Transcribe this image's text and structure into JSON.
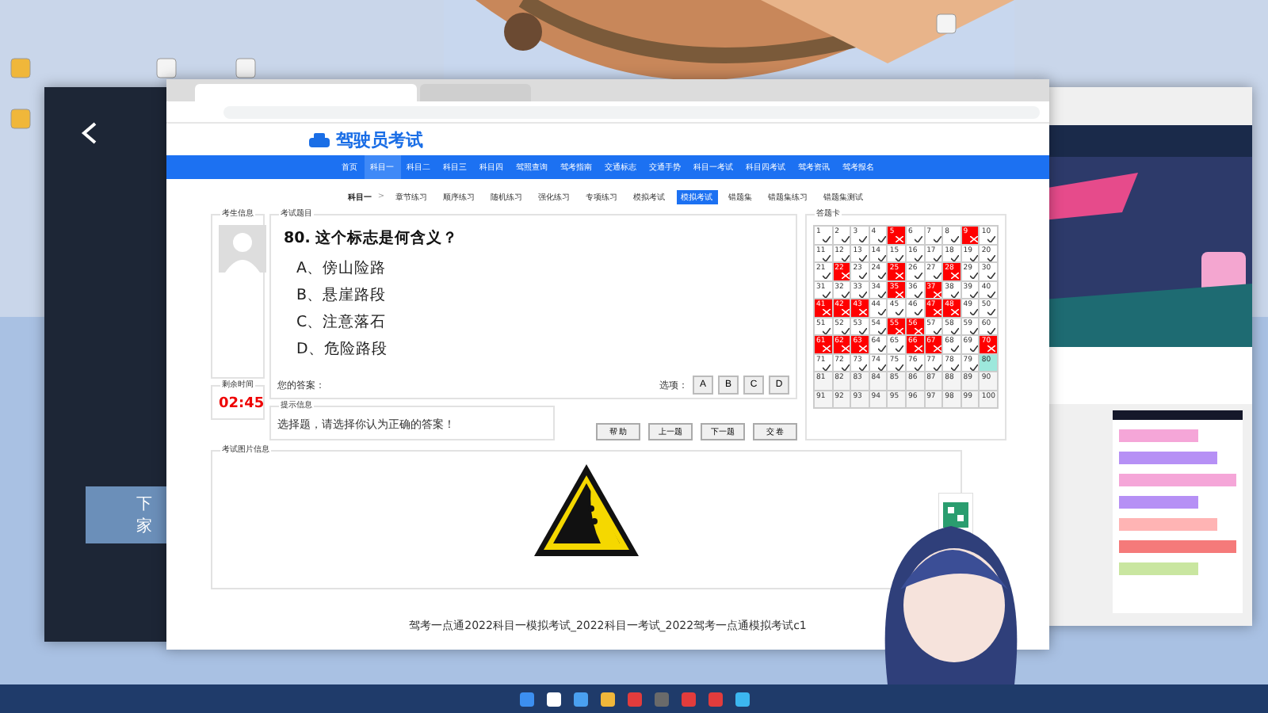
{
  "site": {
    "logo": "驾驶员考试"
  },
  "nav": [
    {
      "label": "首页",
      "selected": false
    },
    {
      "label": "科目一",
      "selected": true
    },
    {
      "label": "科目二",
      "selected": false
    },
    {
      "label": "科目三",
      "selected": false
    },
    {
      "label": "科目四",
      "selected": false
    },
    {
      "label": "驾照查询",
      "selected": false
    },
    {
      "label": "驾考指南",
      "selected": false
    },
    {
      "label": "交通标志",
      "selected": false
    },
    {
      "label": "交通手势",
      "selected": false
    },
    {
      "label": "科目一考试",
      "selected": false
    },
    {
      "label": "科目四考试",
      "selected": false
    },
    {
      "label": "驾考资讯",
      "selected": false
    },
    {
      "label": "驾考报名",
      "selected": false
    }
  ],
  "subnav": {
    "crumb": "科目一",
    "separator": ">",
    "items": [
      {
        "label": "章节练习",
        "selected": false
      },
      {
        "label": "顺序练习",
        "selected": false
      },
      {
        "label": "随机练习",
        "selected": false
      },
      {
        "label": "强化练习",
        "selected": false
      },
      {
        "label": "专项练习",
        "selected": false
      },
      {
        "label": "模拟考试",
        "selected": false
      },
      {
        "label": "模拟考试",
        "selected": true
      },
      {
        "label": "错题集",
        "selected": false
      },
      {
        "label": "错题集练习",
        "selected": false
      },
      {
        "label": "错题集测试",
        "selected": false
      }
    ]
  },
  "exam": {
    "student_legend": "考生信息",
    "timer_legend": "剩余时间",
    "timer": "02:45",
    "question_legend": "考试题目",
    "question": "80. 这个标志是何含义？",
    "options": [
      "A、傍山险路",
      "B、悬崖路段",
      "C、注意落石",
      "D、危险路段"
    ],
    "answer_label": "您的答案：",
    "choose_label": "选项：",
    "choices": [
      "A",
      "B",
      "C",
      "D"
    ],
    "hint_legend": "提示信息",
    "hint": "选择题，请选择你认为正确的答案！",
    "buttons": [
      "帮 助",
      "上一题",
      "下一题",
      "交 卷"
    ],
    "card_legend": "答题卡",
    "image_legend": "考试图片信息"
  },
  "answer_card": [
    {
      "n": "1",
      "answered": true,
      "wrong": false,
      "current": false
    },
    {
      "n": "2",
      "answered": true,
      "wrong": false,
      "current": false
    },
    {
      "n": "3",
      "answered": true,
      "wrong": false,
      "current": false
    },
    {
      "n": "4",
      "answered": true,
      "wrong": false,
      "current": false
    },
    {
      "n": "5",
      "answered": true,
      "wrong": true,
      "current": false
    },
    {
      "n": "6",
      "answered": true,
      "wrong": false,
      "current": false
    },
    {
      "n": "7",
      "answered": true,
      "wrong": false,
      "current": false
    },
    {
      "n": "8",
      "answered": true,
      "wrong": false,
      "current": false
    },
    {
      "n": "9",
      "answered": true,
      "wrong": true,
      "current": false
    },
    {
      "n": "10",
      "answered": true,
      "wrong": false,
      "current": false
    },
    {
      "n": "11",
      "answered": true,
      "wrong": false,
      "current": false
    },
    {
      "n": "12",
      "answered": true,
      "wrong": false,
      "current": false
    },
    {
      "n": "13",
      "answered": true,
      "wrong": false,
      "current": false
    },
    {
      "n": "14",
      "answered": true,
      "wrong": false,
      "current": false
    },
    {
      "n": "15",
      "answered": true,
      "wrong": false,
      "current": false
    },
    {
      "n": "16",
      "answered": true,
      "wrong": false,
      "current": false
    },
    {
      "n": "17",
      "answered": true,
      "wrong": false,
      "current": false
    },
    {
      "n": "18",
      "answered": true,
      "wrong": false,
      "current": false
    },
    {
      "n": "19",
      "answered": true,
      "wrong": false,
      "current": false
    },
    {
      "n": "20",
      "answered": true,
      "wrong": false,
      "current": false
    },
    {
      "n": "21",
      "answered": true,
      "wrong": false,
      "current": false
    },
    {
      "n": "22",
      "answered": true,
      "wrong": true,
      "current": false
    },
    {
      "n": "23",
      "answered": true,
      "wrong": false,
      "current": false
    },
    {
      "n": "24",
      "answered": true,
      "wrong": false,
      "current": false
    },
    {
      "n": "25",
      "answered": true,
      "wrong": true,
      "current": false
    },
    {
      "n": "26",
      "answered": true,
      "wrong": false,
      "current": false
    },
    {
      "n": "27",
      "answered": true,
      "wrong": false,
      "current": false
    },
    {
      "n": "28",
      "answered": true,
      "wrong": true,
      "current": false
    },
    {
      "n": "29",
      "answered": true,
      "wrong": false,
      "current": false
    },
    {
      "n": "30",
      "answered": true,
      "wrong": false,
      "current": false
    },
    {
      "n": "31",
      "answered": true,
      "wrong": false,
      "current": false
    },
    {
      "n": "32",
      "answered": true,
      "wrong": false,
      "current": false
    },
    {
      "n": "33",
      "answered": true,
      "wrong": false,
      "current": false
    },
    {
      "n": "34",
      "answered": true,
      "wrong": false,
      "current": false
    },
    {
      "n": "35",
      "answered": true,
      "wrong": true,
      "current": false
    },
    {
      "n": "36",
      "answered": true,
      "wrong": false,
      "current": false
    },
    {
      "n": "37",
      "answered": true,
      "wrong": true,
      "current": false
    },
    {
      "n": "38",
      "answered": true,
      "wrong": false,
      "current": false
    },
    {
      "n": "39",
      "answered": true,
      "wrong": false,
      "current": false
    },
    {
      "n": "40",
      "answered": true,
      "wrong": false,
      "current": false
    },
    {
      "n": "41",
      "answered": true,
      "wrong": true,
      "current": false
    },
    {
      "n": "42",
      "answered": true,
      "wrong": true,
      "current": false
    },
    {
      "n": "43",
      "answered": true,
      "wrong": true,
      "current": false
    },
    {
      "n": "44",
      "answered": true,
      "wrong": false,
      "current": false
    },
    {
      "n": "45",
      "answered": true,
      "wrong": false,
      "current": false
    },
    {
      "n": "46",
      "answered": true,
      "wrong": false,
      "current": false
    },
    {
      "n": "47",
      "answered": true,
      "wrong": true,
      "current": false
    },
    {
      "n": "48",
      "answered": true,
      "wrong": true,
      "current": false
    },
    {
      "n": "49",
      "answered": true,
      "wrong": false,
      "current": false
    },
    {
      "n": "50",
      "answered": true,
      "wrong": false,
      "current": false
    },
    {
      "n": "51",
      "answered": true,
      "wrong": false,
      "current": false
    },
    {
      "n": "52",
      "answered": true,
      "wrong": false,
      "current": false
    },
    {
      "n": "53",
      "answered": true,
      "wrong": false,
      "current": false
    },
    {
      "n": "54",
      "answered": true,
      "wrong": false,
      "current": false
    },
    {
      "n": "55",
      "answered": true,
      "wrong": true,
      "current": false
    },
    {
      "n": "56",
      "answered": true,
      "wrong": true,
      "current": false
    },
    {
      "n": "57",
      "answered": true,
      "wrong": false,
      "current": false
    },
    {
      "n": "58",
      "answered": true,
      "wrong": false,
      "current": false
    },
    {
      "n": "59",
      "answered": true,
      "wrong": false,
      "current": false
    },
    {
      "n": "60",
      "answered": true,
      "wrong": false,
      "current": false
    },
    {
      "n": "61",
      "answered": true,
      "wrong": true,
      "current": false
    },
    {
      "n": "62",
      "answered": true,
      "wrong": true,
      "current": false
    },
    {
      "n": "63",
      "answered": true,
      "wrong": true,
      "current": false
    },
    {
      "n": "64",
      "answered": true,
      "wrong": false,
      "current": false
    },
    {
      "n": "65",
      "answered": true,
      "wrong": false,
      "current": false
    },
    {
      "n": "66",
      "answered": true,
      "wrong": true,
      "current": false
    },
    {
      "n": "67",
      "answered": true,
      "wrong": true,
      "current": false
    },
    {
      "n": "68",
      "answered": true,
      "wrong": false,
      "current": false
    },
    {
      "n": "69",
      "answered": true,
      "wrong": false,
      "current": false
    },
    {
      "n": "70",
      "answered": true,
      "wrong": true,
      "current": false
    },
    {
      "n": "71",
      "answered": true,
      "wrong": false,
      "current": false
    },
    {
      "n": "72",
      "answered": true,
      "wrong": false,
      "current": false
    },
    {
      "n": "73",
      "answered": true,
      "wrong": false,
      "current": false
    },
    {
      "n": "74",
      "answered": true,
      "wrong": false,
      "current": false
    },
    {
      "n": "75",
      "answered": true,
      "wrong": false,
      "current": false
    },
    {
      "n": "76",
      "answered": true,
      "wrong": false,
      "current": false
    },
    {
      "n": "77",
      "answered": true,
      "wrong": false,
      "current": false
    },
    {
      "n": "78",
      "answered": true,
      "wrong": false,
      "current": false
    },
    {
      "n": "79",
      "answered": true,
      "wrong": false,
      "current": false
    },
    {
      "n": "80",
      "answered": false,
      "wrong": false,
      "current": true
    },
    {
      "n": "81",
      "answered": false,
      "wrong": false,
      "current": false
    },
    {
      "n": "82",
      "answered": false,
      "wrong": false,
      "current": false
    },
    {
      "n": "83",
      "answered": false,
      "wrong": false,
      "current": false
    },
    {
      "n": "84",
      "answered": false,
      "wrong": false,
      "current": false
    },
    {
      "n": "85",
      "answered": false,
      "wrong": false,
      "current": false
    },
    {
      "n": "86",
      "answered": false,
      "wrong": false,
      "current": false
    },
    {
      "n": "87",
      "answered": false,
      "wrong": false,
      "current": false
    },
    {
      "n": "88",
      "answered": false,
      "wrong": false,
      "current": false
    },
    {
      "n": "89",
      "answered": false,
      "wrong": false,
      "current": false
    },
    {
      "n": "90",
      "answered": false,
      "wrong": false,
      "current": false
    },
    {
      "n": "91",
      "answered": false,
      "wrong": false,
      "current": false
    },
    {
      "n": "92",
      "answered": false,
      "wrong": false,
      "current": false
    },
    {
      "n": "93",
      "answered": false,
      "wrong": false,
      "current": false
    },
    {
      "n": "94",
      "answered": false,
      "wrong": false,
      "current": false
    },
    {
      "n": "95",
      "answered": false,
      "wrong": false,
      "current": false
    },
    {
      "n": "96",
      "answered": false,
      "wrong": false,
      "current": false
    },
    {
      "n": "97",
      "answered": false,
      "wrong": false,
      "current": false
    },
    {
      "n": "98",
      "answered": false,
      "wrong": false,
      "current": false
    },
    {
      "n": "99",
      "answered": false,
      "wrong": false,
      "current": false
    },
    {
      "n": "100",
      "answered": false,
      "wrong": false,
      "current": false
    }
  ],
  "footer": "驾考一点通2022科目一模拟考试_2022科目一考试_2022驾考一点通模拟考试c1",
  "side_window": {
    "card": "下家"
  }
}
